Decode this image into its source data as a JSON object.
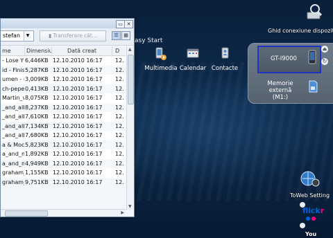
{
  "explorer": {
    "device_combo": "stefan",
    "transfer_button": "Transferare căt...",
    "columns": [
      "me",
      "Dimensiun",
      "Dată creat",
      "D"
    ],
    "rows": [
      {
        "name": "- Lose Y",
        "size": "6,446KB",
        "date": "12.10.2010 16:17",
        "extra": "12."
      },
      {
        "name": "id - Finis",
        "size": "5,287KB",
        "date": "12.10.2010 16:17",
        "extra": "12."
      },
      {
        "name": "umen - (",
        "size": "3,009KB",
        "date": "12.10.2010 16:17",
        "extra": "12."
      },
      {
        "name": "ch-pepes",
        "size": "0,413KB",
        "date": "12.10.2010 16:17",
        "extra": "12."
      },
      {
        "name": "Martin_vs",
        "size": "8,075KB",
        "date": "12.10.2010 16:17",
        "extra": "12."
      },
      {
        "name": "_and_alb",
        "size": "8,237KB",
        "date": "12.10.2010 16:17",
        "extra": "12."
      },
      {
        "name": "_and_alb",
        "size": "7,610KB",
        "date": "12.10.2010 16:17",
        "extra": "12."
      },
      {
        "name": "_and_alb",
        "size": "7,134KB",
        "date": "12.10.2010 16:17",
        "extra": "12."
      },
      {
        "name": "_and_alb",
        "size": "7,680KB",
        "date": "12.10.2010 16:17",
        "extra": "12."
      },
      {
        "name": "a & Moc",
        "size": "5,823KB",
        "date": "12.10.2010 16:17",
        "extra": "12."
      },
      {
        "name": "a_and_m",
        "size": "1,892KB",
        "date": "12.10.2010 16:17",
        "extra": "12."
      },
      {
        "name": "a_and_m",
        "size": "4,949KB",
        "date": "12.10.2010 16:17",
        "extra": "12."
      },
      {
        "name": "graham_",
        "size": "1,155KB",
        "date": "12.10.2010 16:17",
        "extra": "12."
      },
      {
        "name": "graham_",
        "size": "9,751KB",
        "date": "12.10.2010 16:17",
        "extra": "12."
      },
      {
        "name": "",
        "size": "",
        "date": "",
        "extra": ""
      }
    ]
  },
  "easy_start": {
    "title": "asy Start",
    "items": [
      {
        "label": "Multimedia",
        "icon": "multimedia-icon"
      },
      {
        "label": "Calendar",
        "icon": "calendar-icon"
      },
      {
        "label": "Contacte",
        "icon": "contacts-icon"
      }
    ],
    "device_name": "GT-I9000",
    "external_memory": "Memorie externă",
    "external_memory_sub": "(M1:)"
  },
  "desktop": {
    "guide_label": "Ghid conexiune dispozitiv",
    "toweb_label": "ToWeb Setting",
    "flickr_label": "flickr",
    "youtube_label": "You"
  },
  "colors": {
    "selection_border": "#2034c4",
    "desktop_bg": "#0d2c4f",
    "flickr_blue": "#0063dc",
    "flickr_pink": "#ff0084"
  }
}
